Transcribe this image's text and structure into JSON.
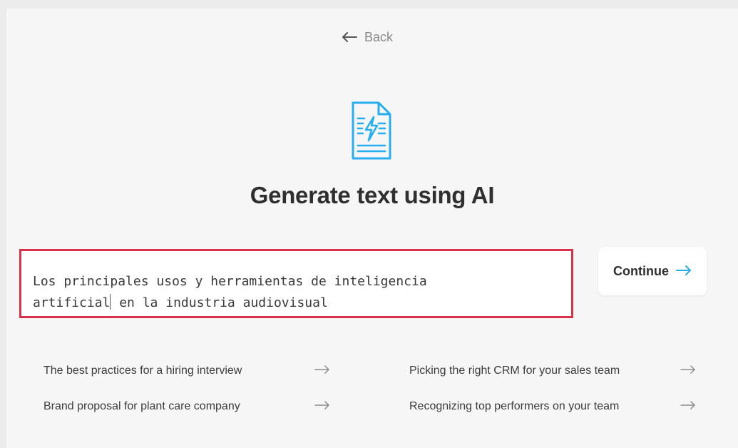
{
  "header": {
    "back_label": "Back"
  },
  "main": {
    "title": "Generate text using AI",
    "prompt_line1": "Los principales usos y herramientas de inteligencia",
    "prompt_line2_before_caret": "artificial",
    "prompt_line2_after_caret": " en la industria audiovisual",
    "continue_label": "Continue"
  },
  "suggestions": [
    {
      "label": "The best practices for a hiring interview"
    },
    {
      "label": "Brand proposal for plant care company"
    },
    {
      "label": "Picking the right CRM for your sales team"
    },
    {
      "label": "Recognizing top performers on your team"
    }
  ],
  "icons": {
    "back": "arrow-left-icon",
    "ai_document": "ai-document-icon",
    "continue": "arrow-right-icon",
    "suggestion": "arrow-right-icon"
  },
  "colors": {
    "accent_blue": "#27aef0",
    "highlight_border": "#d8334a",
    "page_background": "#f6f6f6"
  }
}
